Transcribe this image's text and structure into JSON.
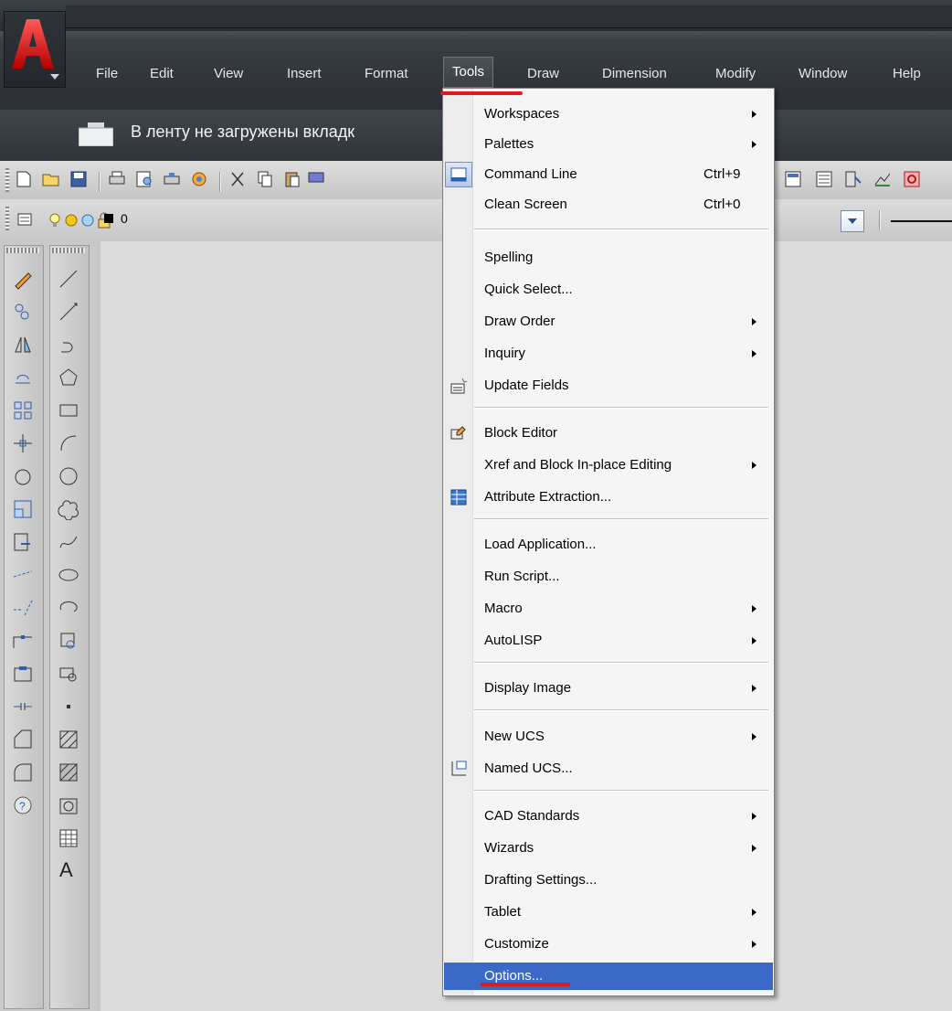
{
  "menubar": {
    "items": [
      {
        "key": "file",
        "label": "File"
      },
      {
        "key": "edit",
        "label": "Edit"
      },
      {
        "key": "view",
        "label": "View"
      },
      {
        "key": "insert",
        "label": "Insert"
      },
      {
        "key": "format",
        "label": "Format"
      },
      {
        "key": "tools",
        "label": "Tools"
      },
      {
        "key": "draw",
        "label": "Draw"
      },
      {
        "key": "dimension",
        "label": "Dimension"
      },
      {
        "key": "modify",
        "label": "Modify"
      },
      {
        "key": "window",
        "label": "Window"
      },
      {
        "key": "help",
        "label": "Help"
      }
    ]
  },
  "ribbon": {
    "message": "В ленту не загружены вкладк"
  },
  "layer_toolbar": {
    "layer_name": "0"
  },
  "tools_menu": {
    "items": [
      {
        "label": "Workspaces",
        "submenu": true
      },
      {
        "label": "Palettes",
        "submenu": true
      },
      {
        "label": "Command Line",
        "shortcut": "Ctrl+9",
        "checked": true,
        "icon": "command-line-icon"
      },
      {
        "label": "Clean Screen",
        "shortcut": "Ctrl+0"
      },
      {
        "label": "Spelling"
      },
      {
        "label": "Quick Select..."
      },
      {
        "label": "Draw Order",
        "submenu": true
      },
      {
        "label": "Inquiry",
        "submenu": true
      },
      {
        "label": "Update Fields",
        "icon": "update-fields-icon"
      },
      {
        "label": "Block Editor",
        "icon": "block-editor-icon"
      },
      {
        "label": "Xref and Block In-place Editing",
        "submenu": true
      },
      {
        "label": "Attribute Extraction...",
        "icon": "attribute-extraction-icon"
      },
      {
        "label": "Load Application..."
      },
      {
        "label": "Run Script..."
      },
      {
        "label": "Macro",
        "submenu": true
      },
      {
        "label": "AutoLISP",
        "submenu": true
      },
      {
        "label": "Display Image",
        "submenu": true
      },
      {
        "label": "New UCS",
        "submenu": true
      },
      {
        "label": "Named UCS...",
        "icon": "named-ucs-icon"
      },
      {
        "label": "CAD Standards",
        "submenu": true
      },
      {
        "label": "Wizards",
        "submenu": true
      },
      {
        "label": "Drafting Settings..."
      },
      {
        "label": "Tablet",
        "submenu": true
      },
      {
        "label": "Customize",
        "submenu": true
      },
      {
        "label": "Options...",
        "selected": true
      }
    ]
  },
  "annotations": {
    "highlight_color": "#e0191b"
  },
  "colors": {
    "selection": "#3a69c8",
    "chrome": "#2b2f35",
    "canvas": "#dbdbdb"
  },
  "draw_toolbar": {
    "text_tool_label": "A"
  }
}
